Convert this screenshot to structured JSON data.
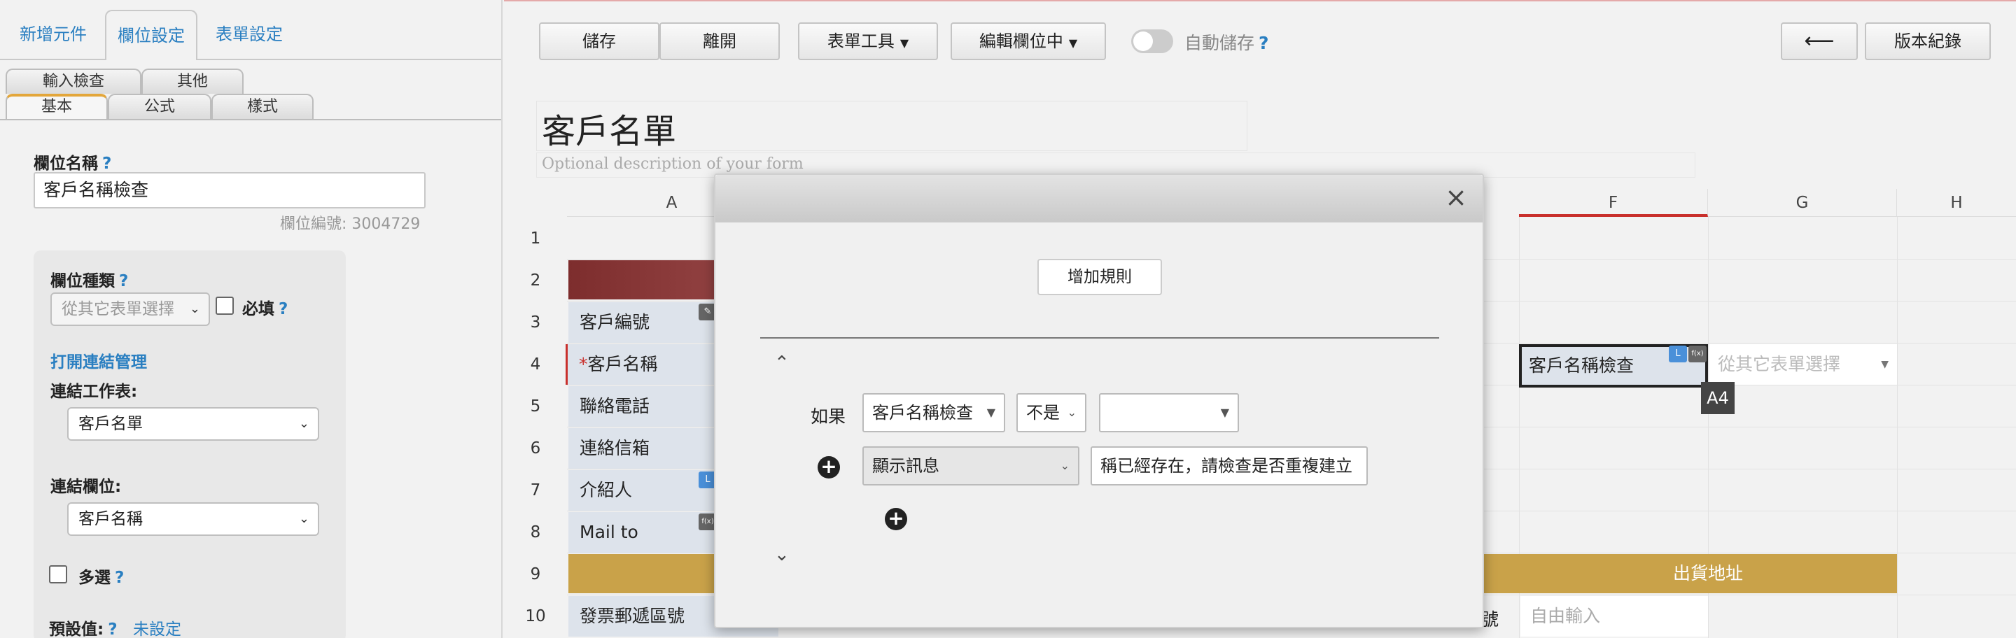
{
  "left_panel": {
    "top_tabs": [
      "新增元件",
      "欄位設定",
      "表單設定"
    ],
    "sub_tabs_row1": [
      "輸入檢查",
      "其他"
    ],
    "sub_tabs_row2": [
      "基本",
      "公式",
      "樣式"
    ],
    "field_name_label": "欄位名稱",
    "help": "?",
    "field_name_value": "客戶名稱檢查",
    "field_id": "欄位編號: 3004729",
    "field_type_label": "欄位種類",
    "field_type_value": "從其它表單選擇",
    "required_label": "必填",
    "open_link_manager": "打開連結管理",
    "link_sheet_label": "連結工作表:",
    "link_sheet_value": "客戶名單",
    "link_field_label": "連結欄位:",
    "link_field_value": "客戶名稱",
    "multi_label": "多選",
    "default_label": "預設值:",
    "default_value": "未設定"
  },
  "toolbar": {
    "save": "儲存",
    "leave": "離開",
    "form_tools": "表單工具",
    "editing": "編輯欄位中",
    "autosave": "自動儲存",
    "help": "?",
    "back_arrow": "⟵",
    "versions": "版本紀錄"
  },
  "form": {
    "title": "客戶名單",
    "description_placeholder": "Optional description of your form"
  },
  "grid": {
    "columns": [
      "A",
      "F",
      "G",
      "H"
    ],
    "rows": [
      "1",
      "2",
      "3",
      "4",
      "5",
      "6",
      "7",
      "8",
      "9",
      "10"
    ],
    "col_a_cells": [
      "客戶編號",
      "客戶名稱",
      "聯絡電話",
      "連絡信箱",
      "介紹人",
      "Mail to",
      "發票郵遞區號"
    ],
    "required_mark": "*",
    "f4_value": "客戶名稱檢查",
    "g4_placeholder": "從其它表單選擇",
    "cell_ref": "A4",
    "shipping_address": "出貨地址",
    "f10_placeholder": "自由輸入",
    "e10_partial": "號",
    "badges": {
      "link": "L",
      "formula": "f(x)"
    }
  },
  "dialog": {
    "close": "×",
    "add_rule": "增加規則",
    "if_label": "如果",
    "cond_field": "客戶名稱檢查",
    "cond_operator": "不是",
    "cond_value": "",
    "action": "顯示訊息",
    "message_value": "稱已經存在，請檢查是否重複建立"
  }
}
